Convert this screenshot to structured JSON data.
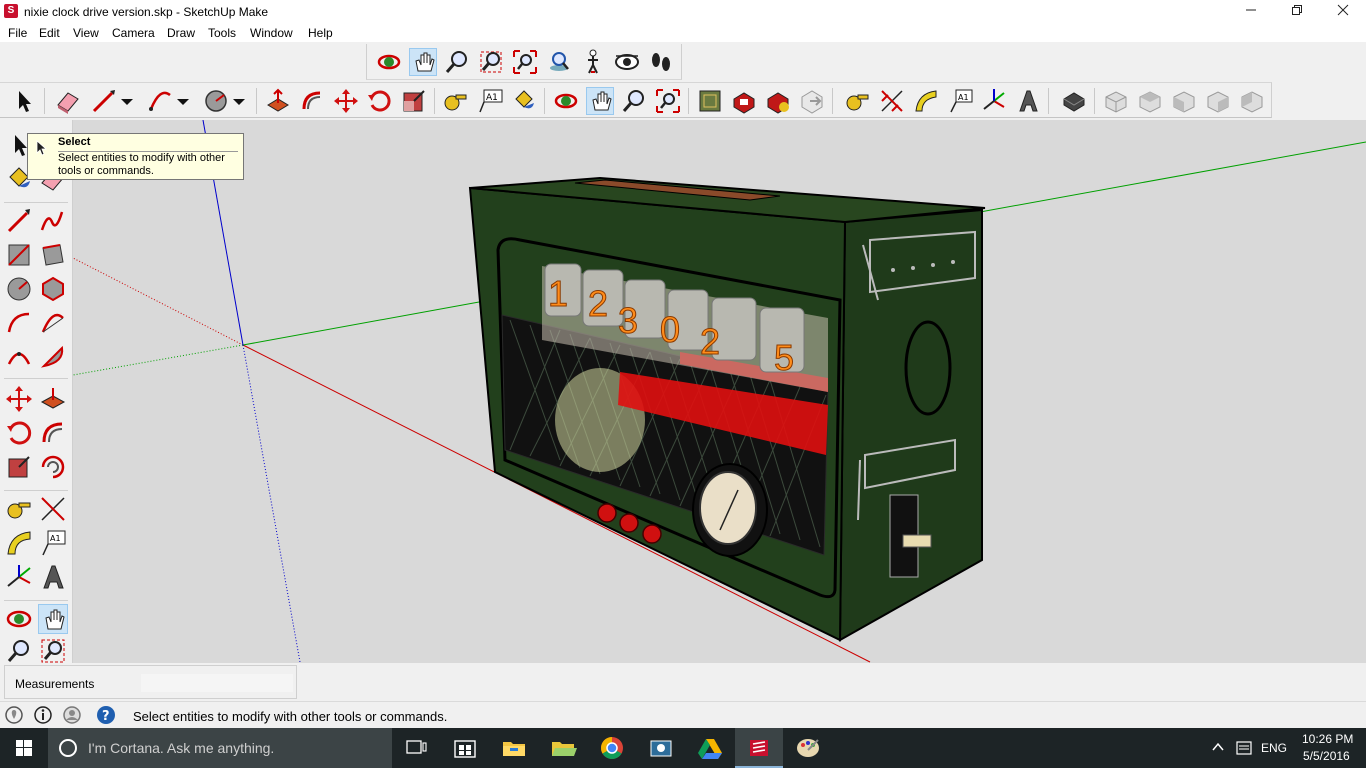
{
  "window": {
    "title": "nixie clock drive version.skp - SketchUp Make",
    "app_icon": "sketchup-logo-icon",
    "controls": [
      "minimize-icon",
      "maximize-icon",
      "close-icon"
    ]
  },
  "menu": {
    "items": [
      "File",
      "Edit",
      "View",
      "Camera",
      "Draw",
      "Tools",
      "Window",
      "Help"
    ]
  },
  "toolbar_top": {
    "icons": [
      "orbit-icon",
      "pan-icon",
      "zoom-icon",
      "zoom-window-icon",
      "zoom-extents-icon",
      "position-camera-icon",
      "walk-icon",
      "look-around-icon",
      "footprints-icon"
    ],
    "active": "pan-icon"
  },
  "toolbar_main": {
    "groups": [
      [
        "select-icon"
      ],
      [
        "eraser-icon",
        "line-icon",
        "dropdown-arrow-icon",
        "arc-icon",
        "dropdown-arrow-icon",
        "circle-icon",
        "dropdown-arrow-icon"
      ],
      [
        "push-pull-icon",
        "follow-me-icon",
        "move-icon",
        "rotate-icon",
        "scale-icon"
      ],
      [
        "tape-measure-icon",
        "text-icon",
        "paint-bucket-icon"
      ],
      [
        "orbit-icon",
        "pan-icon",
        "zoom-icon",
        "zoom-extents-icon"
      ],
      [
        "3d-warehouse-icon",
        "extension-warehouse-icon",
        "layout-icon",
        "share-model-icon"
      ],
      [
        "tape-measure-icon",
        "dimensions-icon",
        "protractor-icon",
        "3d-text-icon",
        "axes-icon",
        "3d-text-tool-icon"
      ],
      [
        "section-plane-icon"
      ],
      [
        "iso-view-icon",
        "top-view-icon",
        "front-view-icon",
        "right-view-icon",
        "back-view-icon"
      ]
    ],
    "active": "pan-icon"
  },
  "left_palette": {
    "icons": [
      "select-icon",
      "eraser-icon",
      "paint-bucket-icon",
      "line-icon",
      "freehand-icon",
      "rectangle-icon",
      "rotated-rectangle-icon",
      "circle-icon",
      "polygon-icon",
      "arc-icon",
      "two-point-arc-icon",
      "three-point-arc-icon",
      "pie-icon",
      "move-icon",
      "push-pull-icon",
      "rotate-icon",
      "follow-me-icon",
      "scale-icon",
      "offset-icon",
      "tape-measure-icon",
      "dimensions-icon",
      "protractor-icon",
      "text-icon",
      "axes-icon",
      "3d-text-icon",
      "orbit-icon",
      "pan-icon",
      "zoom-icon",
      "zoom-window-icon"
    ],
    "active": "pan-icon"
  },
  "tooltip": {
    "title": "Select",
    "description_line1": "Select entities to modify with other",
    "description_line2": "tools or commands."
  },
  "model": {
    "nixie_digits": [
      "1",
      "2",
      "3",
      "0",
      "2",
      "5"
    ],
    "body_color": "#1f3a1a",
    "digit_color": "#ff8c1a",
    "accent_red": "#e01010",
    "knob_color": "#d01010"
  },
  "axes_colors": {
    "red": "#cc0000",
    "green": "#00aa00",
    "blue": "#0000cc"
  },
  "measurements": {
    "label": "Measurements",
    "value": ""
  },
  "status": {
    "icons": [
      "geo-location-icon",
      "credits-icon",
      "user-account-icon",
      "help-icon"
    ],
    "text": "Select entities to modify with other tools or commands."
  },
  "taskbar": {
    "start_icon": "windows-start-icon",
    "search_icon": "cortana-circle-icon",
    "search_placeholder": "I'm Cortana. Ask me anything.",
    "apps": [
      "task-view-icon",
      "store-icon",
      "file-explorer-icon",
      "folder-icon",
      "chrome-icon",
      "camera-app-icon",
      "google-drive-icon",
      "sketchup-icon",
      "paint-icon"
    ],
    "active_app": "sketchup-icon",
    "tray_icons": [
      "chevron-up-icon",
      "action-center-icon"
    ],
    "language": "ENG",
    "time": "10:26 PM",
    "date": "5/5/2016"
  }
}
